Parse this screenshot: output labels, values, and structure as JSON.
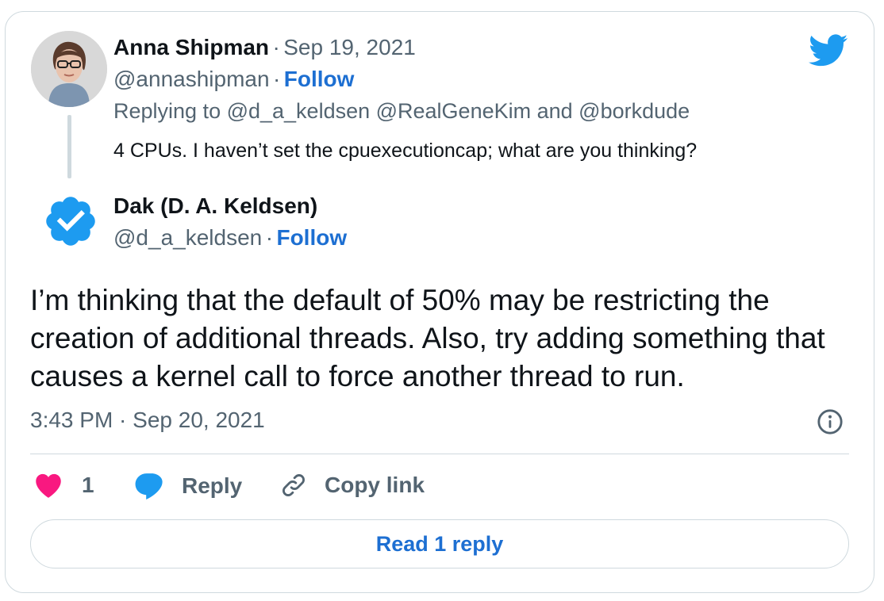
{
  "colors": {
    "accent": "#1d6fd2",
    "like": "#f91880",
    "verified": "#1d9bf0",
    "muted": "#536471",
    "twitter": "#1d9bf0"
  },
  "parent": {
    "name": "Anna Shipman",
    "separator": "·",
    "date": "Sep 19, 2021",
    "handle": "@annashipman",
    "follow": "Follow",
    "replying_to": "Replying to @d_a_keldsen @RealGeneKim and @borkdude",
    "text": "4 CPUs. I haven’t set the cpuexecutioncap; what are you thinking?"
  },
  "tweet": {
    "name": "Dak (D. A. Keldsen)",
    "handle": "@d_a_keldsen",
    "separator": "·",
    "follow": "Follow",
    "text": "I’m thinking that the default of 50% may be restricting the creation of additional threads. Also, try adding something that causes a kernel call to force another thread to run.",
    "timestamp": "3:43 PM · Sep 20, 2021"
  },
  "actions": {
    "like_count": "1",
    "reply_label": "Reply",
    "copy_link_label": "Copy link",
    "read_replies_label": "Read 1 reply"
  },
  "icons": [
    "twitter-bird-icon",
    "verified-badge-icon",
    "info-icon",
    "heart-icon",
    "reply-bubble-icon",
    "link-icon"
  ]
}
